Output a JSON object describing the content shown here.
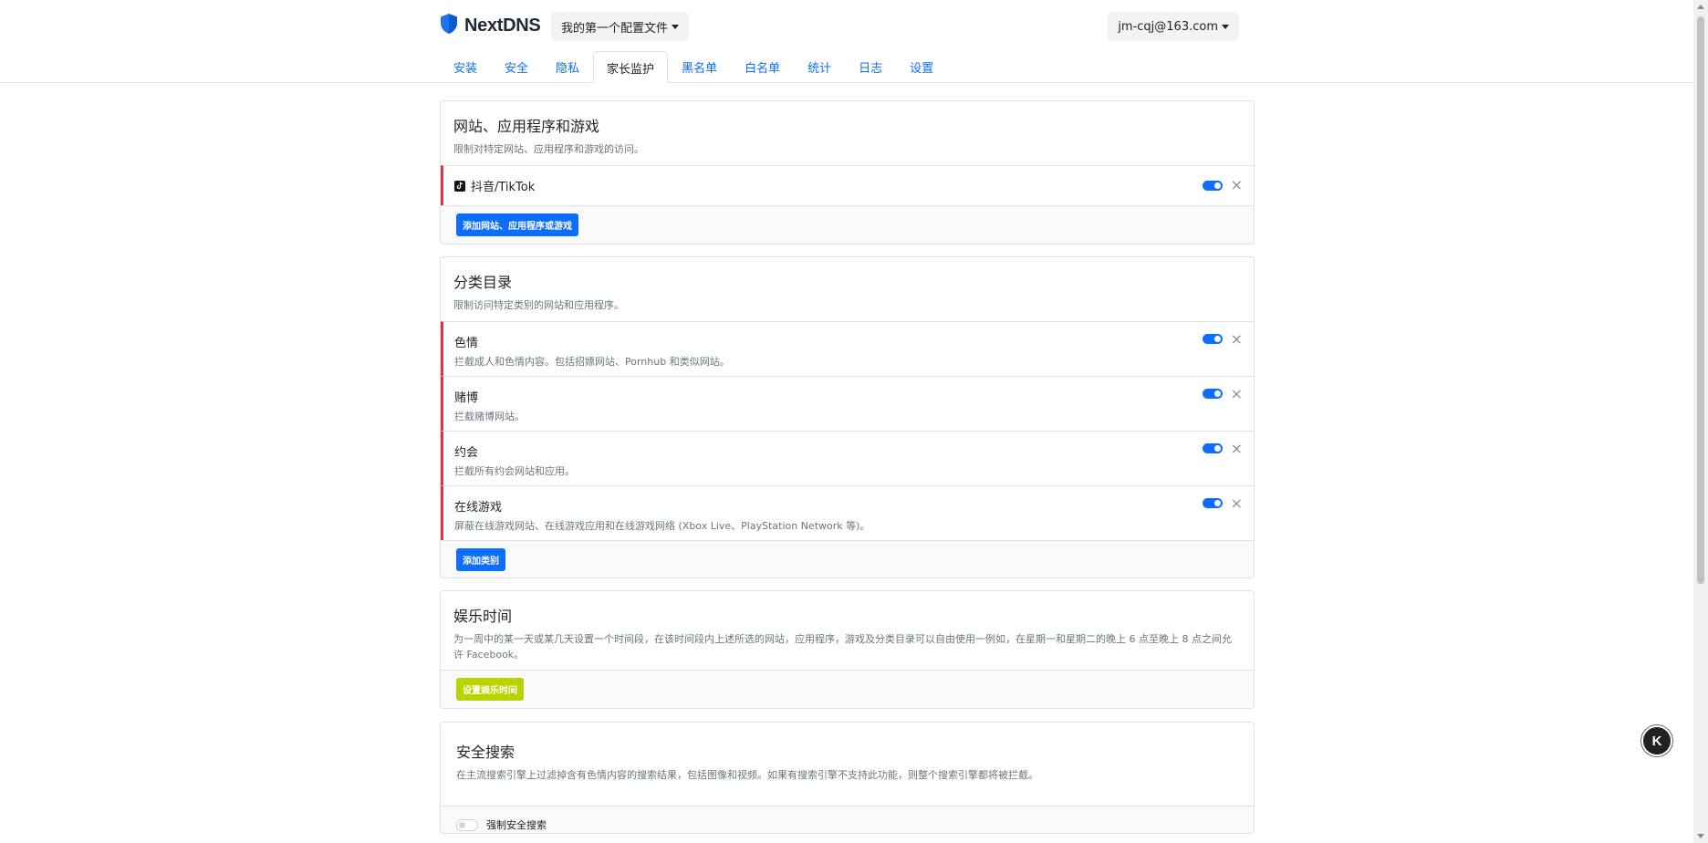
{
  "header": {
    "brand": "NextDNS",
    "profile_label": "我的第一个配置文件",
    "account_label": "jm-cqj@163.com"
  },
  "tabs": [
    {
      "label": "安装",
      "active": false
    },
    {
      "label": "安全",
      "active": false
    },
    {
      "label": "隐私",
      "active": false
    },
    {
      "label": "家长监护",
      "active": true
    },
    {
      "label": "黑名单",
      "active": false
    },
    {
      "label": "白名单",
      "active": false
    },
    {
      "label": "统计",
      "active": false
    },
    {
      "label": "日志",
      "active": false
    },
    {
      "label": "设置",
      "active": false
    }
  ],
  "websites": {
    "title": "网站、应用程序和游戏",
    "description": "限制对特定网站、应用程序和游戏的访问。",
    "items": [
      {
        "name": "抖音/TikTok",
        "icon": "tiktok-icon",
        "enabled": true
      }
    ],
    "add_button": "添加网站、应用程序或游戏"
  },
  "categories": {
    "title": "分类目录",
    "description": "限制访问特定类别的网站和应用程序。",
    "items": [
      {
        "name": "色情",
        "desc": "拦截成人和色情内容。包括招嫖网站、Pornhub 和类似网站。",
        "enabled": true
      },
      {
        "name": "赌博",
        "desc": "拦截赌博网站。",
        "enabled": true
      },
      {
        "name": "约会",
        "desc": "拦截所有约会网站和应用。",
        "enabled": true
      },
      {
        "name": "在线游戏",
        "desc": "屏蔽在线游戏网站、在线游戏应用和在线游戏网络 (Xbox Live、PlayStation Network 等)。",
        "enabled": true
      }
    ],
    "add_button": "添加类别"
  },
  "recreation": {
    "title": "娱乐时间",
    "description": "为一周中的某一天或某几天设置一个时间段，在该时间段内上述所选的网站，应用程序，游戏及分类目录可以自由使用一例如，在星期一和星期二的晚上 6 点至晚上 8 点之间允许 Facebook。",
    "button": "设置娱乐时间"
  },
  "safesearch": {
    "title": "安全搜索",
    "description": "在主流搜索引擎上过滤掉含有色情内容的搜索结果，包括图像和视频。如果有搜索引擎不支持此功能，则整个搜索引擎都将被拦截。",
    "toggle_label": "强制安全搜索",
    "enabled": false
  },
  "floating": {
    "label": "K"
  },
  "colors": {
    "accent": "#0d6efd",
    "danger": "#dc3545",
    "lime": "#b9d300"
  }
}
